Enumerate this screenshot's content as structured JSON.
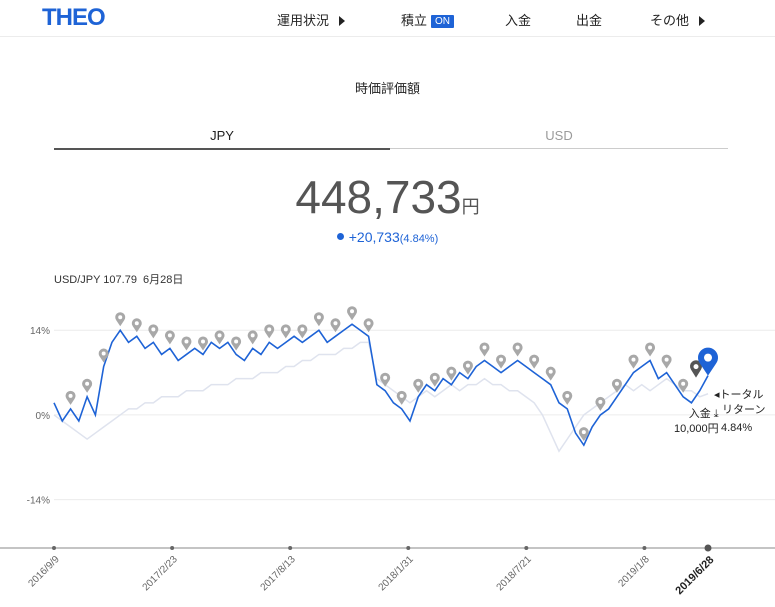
{
  "header": {
    "logo": "THEO",
    "nav": {
      "performance": "運用状況",
      "tsumitate": "積立",
      "tsumitate_badge": "ON",
      "deposit": "入金",
      "withdraw": "出金",
      "other": "その他"
    }
  },
  "summary": {
    "title": "時価評価額",
    "tabs": [
      "JPY",
      "USD"
    ],
    "active_tab": "JPY",
    "amount": "448,733",
    "amount_unit": "円",
    "change": "+20,733",
    "change_pct": "(4.84%)",
    "fx_label": "USD/JPY 107.79",
    "fx_date": "6月28日"
  },
  "chart_data": {
    "type": "line",
    "y_ticks": [
      "14%",
      "0%",
      "-14%"
    ],
    "ylim": [
      -22,
      19
    ],
    "grid": true,
    "x_tick_labels": [
      "2016/9/9",
      "2017/2/23",
      "2017/8/13",
      "2018/1/31",
      "2018/7/21",
      "2019/1/8",
      "2019/6/28"
    ],
    "x_tick_positions": [
      0,
      0.1806,
      0.3611,
      0.5417,
      0.7222,
      0.9028,
      1.0
    ],
    "series": [
      {
        "role": "portfolio",
        "color": "#1e63d6",
        "values": [
          2,
          -1,
          1,
          -1,
          3,
          0,
          8,
          12,
          14,
          12,
          13,
          11,
          12,
          10,
          11,
          9,
          10,
          11,
          10,
          12,
          11,
          12,
          10,
          9,
          11,
          10,
          12,
          11,
          12,
          13,
          12,
          13,
          14,
          12,
          13,
          14,
          15,
          14,
          13,
          5,
          4,
          2,
          1,
          -1,
          3,
          5,
          4,
          6,
          5,
          7,
          6,
          8,
          9,
          8,
          7,
          8,
          9,
          8,
          7,
          6,
          5,
          2,
          1,
          -3,
          -5,
          -2,
          0,
          1,
          3,
          5,
          7,
          8,
          9,
          6,
          7,
          5,
          3,
          2,
          4,
          6.5
        ],
        "markers_index": [
          2,
          4,
          6,
          8,
          10,
          12,
          14,
          16,
          18,
          20,
          22,
          24,
          26,
          28,
          30,
          32,
          34,
          36,
          38,
          40,
          42,
          44,
          46,
          48,
          50,
          52,
          54,
          56,
          58,
          60,
          62,
          64,
          66,
          68,
          70,
          72,
          74,
          76
        ]
      },
      {
        "role": "benchmark",
        "color": "#dfe3ee",
        "values": [
          0,
          -1,
          -2,
          -3,
          -4,
          -3,
          -2,
          -1,
          0,
          1,
          1,
          2,
          2,
          3,
          3,
          3,
          4,
          4,
          4,
          5,
          5,
          5,
          6,
          6,
          6,
          7,
          7,
          7,
          8,
          8,
          9,
          9,
          10,
          10,
          10,
          11,
          11,
          12,
          12,
          6,
          5,
          4,
          3,
          2,
          3,
          4,
          3,
          4,
          5,
          4,
          5,
          5,
          6,
          5,
          5,
          4,
          4,
          3,
          2,
          0,
          -3,
          -6,
          -4,
          -2,
          0,
          1,
          2,
          3,
          4,
          5,
          4,
          5,
          4,
          5,
          6,
          5,
          4,
          4,
          3,
          3.5
        ]
      }
    ]
  },
  "annotations": {
    "total_return_arrow": "◂",
    "total_return_l1": "トータル",
    "total_return_l2": "リターン",
    "deposit_label": "入金",
    "deposit_icon": "download-icon",
    "deposit_amount": "10,000円",
    "return_pct": "4.84%"
  }
}
